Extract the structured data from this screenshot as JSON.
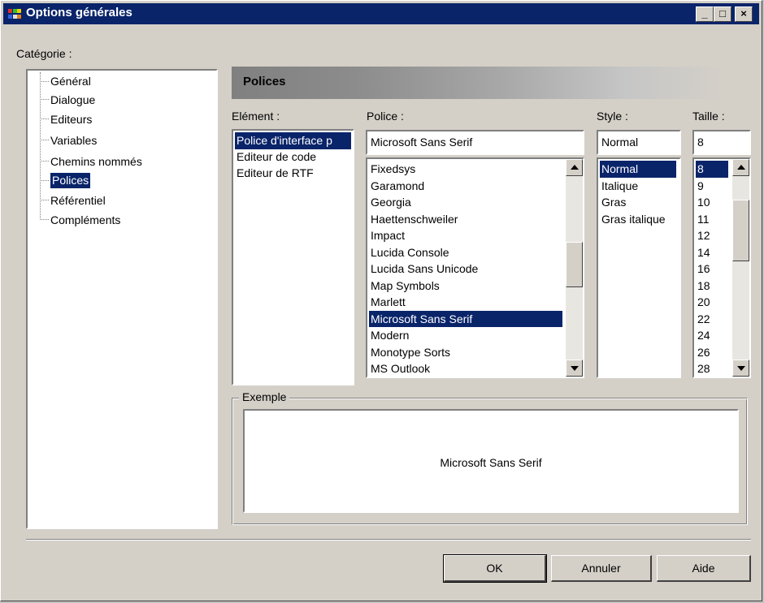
{
  "window": {
    "title": "Options générales",
    "controls": [
      "_",
      "□",
      "×"
    ]
  },
  "category": {
    "label": "Catégorie :",
    "items": [
      "Général",
      "Dialogue",
      "Editeurs",
      "Variables",
      "Chemins nommés",
      "Polices",
      "Référentiel",
      "Compléments"
    ],
    "selected": "Polices"
  },
  "panel": {
    "header": "Polices"
  },
  "element": {
    "label": "Elément :",
    "items": [
      "Police d'interface p",
      "Editeur de code",
      "Editeur de RTF"
    ],
    "selected": "Police d'interface p"
  },
  "police": {
    "label": "Police :",
    "value": "Microsoft Sans Serif",
    "items": [
      "Fixedsys",
      "Garamond",
      "Georgia",
      "Haettenschweiler",
      "Impact",
      "Lucida Console",
      "Lucida Sans Unicode",
      "Map Symbols",
      "Marlett",
      "Microsoft Sans Serif",
      "Modern",
      "Monotype Sorts",
      "MS Outlook"
    ],
    "selected": "Microsoft Sans Serif"
  },
  "style": {
    "label": "Style :",
    "value": "Normal",
    "items": [
      "Normal",
      "Italique",
      "Gras",
      "Gras italique"
    ],
    "selected": "Normal"
  },
  "taille": {
    "label": "Taille :",
    "value": "8",
    "items": [
      "8",
      "9",
      "10",
      "11",
      "12",
      "14",
      "16",
      "18",
      "20",
      "22",
      "24",
      "26",
      "28"
    ],
    "selected": "8"
  },
  "example": {
    "label": "Exemple",
    "text": "Microsoft Sans Serif"
  },
  "buttons": {
    "ok": "OK",
    "cancel": "Annuler",
    "help": "Aide"
  },
  "colors": {
    "titlebar": "#0a246a",
    "face": "#d4d0c8",
    "selection": "#0a246a"
  }
}
